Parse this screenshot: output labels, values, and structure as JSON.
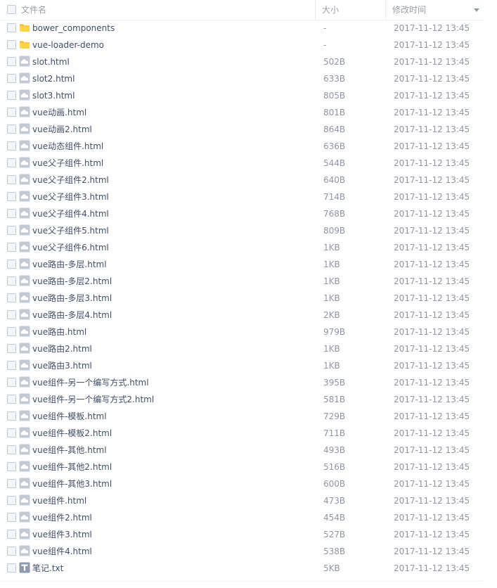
{
  "header": {
    "name_label": "文件名",
    "size_label": "大小",
    "date_label": "修改时间"
  },
  "colors": {
    "folder": "#ffd157",
    "folder_tab": "#f7b528",
    "file_icon": "#c3cad5",
    "text_icon": "#8e9aac",
    "name_text": "#424e67",
    "meta_text": "#8f96a3"
  },
  "files": [
    {
      "name": "bower_components",
      "size": "-",
      "date": "2017-11-12 13:45",
      "icon": "folder-icon"
    },
    {
      "name": "vue-loader-demo",
      "size": "-",
      "date": "2017-11-12 13:45",
      "icon": "folder-icon"
    },
    {
      "name": "slot.html",
      "size": "502B",
      "date": "2017-11-12 13:45",
      "icon": "html-file-icon"
    },
    {
      "name": "slot2.html",
      "size": "633B",
      "date": "2017-11-12 13:45",
      "icon": "html-file-icon"
    },
    {
      "name": "slot3.html",
      "size": "805B",
      "date": "2017-11-12 13:45",
      "icon": "html-file-icon"
    },
    {
      "name": "vue动画.html",
      "size": "801B",
      "date": "2017-11-12 13:45",
      "icon": "html-file-icon"
    },
    {
      "name": "vue动画2.html",
      "size": "864B",
      "date": "2017-11-12 13:45",
      "icon": "html-file-icon"
    },
    {
      "name": "vue动态组件.html",
      "size": "636B",
      "date": "2017-11-12 13:45",
      "icon": "html-file-icon"
    },
    {
      "name": "vue父子组件.html",
      "size": "544B",
      "date": "2017-11-12 13:45",
      "icon": "html-file-icon"
    },
    {
      "name": "vue父子组件2.html",
      "size": "640B",
      "date": "2017-11-12 13:45",
      "icon": "html-file-icon"
    },
    {
      "name": "vue父子组件3.html",
      "size": "714B",
      "date": "2017-11-12 13:45",
      "icon": "html-file-icon"
    },
    {
      "name": "vue父子组件4.html",
      "size": "768B",
      "date": "2017-11-12 13:45",
      "icon": "html-file-icon"
    },
    {
      "name": "vue父子组件5.html",
      "size": "809B",
      "date": "2017-11-12 13:45",
      "icon": "html-file-icon"
    },
    {
      "name": "vue父子组件6.html",
      "size": "1KB",
      "date": "2017-11-12 13:45",
      "icon": "html-file-icon"
    },
    {
      "name": "vue路由-多层.html",
      "size": "1KB",
      "date": "2017-11-12 13:45",
      "icon": "html-file-icon"
    },
    {
      "name": "vue路由-多层2.html",
      "size": "1KB",
      "date": "2017-11-12 13:45",
      "icon": "html-file-icon"
    },
    {
      "name": "vue路由-多层3.html",
      "size": "1KB",
      "date": "2017-11-12 13:45",
      "icon": "html-file-icon"
    },
    {
      "name": "vue路由-多层4.html",
      "size": "2KB",
      "date": "2017-11-12 13:45",
      "icon": "html-file-icon"
    },
    {
      "name": "vue路由.html",
      "size": "979B",
      "date": "2017-11-12 13:45",
      "icon": "html-file-icon"
    },
    {
      "name": "vue路由2.html",
      "size": "1KB",
      "date": "2017-11-12 13:45",
      "icon": "html-file-icon"
    },
    {
      "name": "vue路由3.html",
      "size": "1KB",
      "date": "2017-11-12 13:45",
      "icon": "html-file-icon"
    },
    {
      "name": "vue组件-另一个编写方式.html",
      "size": "395B",
      "date": "2017-11-12 13:45",
      "icon": "html-file-icon"
    },
    {
      "name": "vue组件-另一个编写方式2.html",
      "size": "581B",
      "date": "2017-11-12 13:45",
      "icon": "html-file-icon"
    },
    {
      "name": "vue组件-模板.html",
      "size": "729B",
      "date": "2017-11-12 13:45",
      "icon": "html-file-icon"
    },
    {
      "name": "vue组件-模板2.html",
      "size": "711B",
      "date": "2017-11-12 13:45",
      "icon": "html-file-icon"
    },
    {
      "name": "vue组件-其他.html",
      "size": "493B",
      "date": "2017-11-12 13:45",
      "icon": "html-file-icon"
    },
    {
      "name": "vue组件-其他2.html",
      "size": "516B",
      "date": "2017-11-12 13:45",
      "icon": "html-file-icon"
    },
    {
      "name": "vue组件-其他3.html",
      "size": "600B",
      "date": "2017-11-12 13:45",
      "icon": "html-file-icon"
    },
    {
      "name": "vue组件.html",
      "size": "473B",
      "date": "2017-11-12 13:45",
      "icon": "html-file-icon"
    },
    {
      "name": "vue组件2.html",
      "size": "454B",
      "date": "2017-11-12 13:45",
      "icon": "html-file-icon"
    },
    {
      "name": "vue组件3.html",
      "size": "527B",
      "date": "2017-11-12 13:45",
      "icon": "html-file-icon"
    },
    {
      "name": "vue组件4.html",
      "size": "538B",
      "date": "2017-11-12 13:45",
      "icon": "html-file-icon"
    },
    {
      "name": "笔记.txt",
      "size": "5KB",
      "date": "2017-11-12 13:45",
      "icon": "text-file-icon"
    }
  ]
}
